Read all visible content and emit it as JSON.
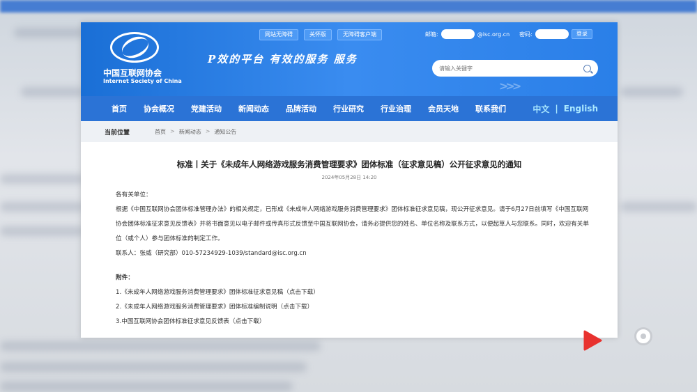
{
  "site": {
    "logo_cn": "中国互联网协会",
    "logo_en": "Internet Society of China",
    "slogan": "P效的平台   有效的服务   服务"
  },
  "topbar": {
    "buttons": [
      "网站无障碍",
      "关怀版",
      "无障碍客户端"
    ],
    "email_label": "邮箱:",
    "email_suffix": "@isc.org.cn",
    "password_label": "密码:",
    "login_label": "登录"
  },
  "search": {
    "placeholder": "请输入关键字"
  },
  "nav": {
    "items": [
      "首页",
      "协会概况",
      "党建活动",
      "新闻动态",
      "品牌活动",
      "行业研究",
      "行业治理",
      "会员天地",
      "联系我们"
    ],
    "lang_cn": "中文",
    "lang_sep": "|",
    "lang_en": "English"
  },
  "breadcrumb": {
    "title": "当前位置",
    "items": [
      "首页",
      "新闻动态",
      "通知公告"
    ],
    "sep": ">"
  },
  "article": {
    "title": "标准丨关于《未成年人网络游戏服务消费管理要求》团体标准（征求意见稿）公开征求意见的通知",
    "date": "2024年05月28日 14:20",
    "greeting": "各有关单位：",
    "para1": "根据《中国互联网协会团体标准管理办法》的相关规定，已形成《未成年人网络游戏服务消费管理要求》团体标准征求意见稿，现公开征求意见。请于6月27日前填写《中国互联网协会团体标准征求意见反馈表》并将书面意见以电子邮件或传真形式反馈至中国互联网协会，请务必提供您的姓名、单位名称及联系方式，以便起草人与您联系。同时，欢迎有关单位（或个人）参与团体标准的制定工作。",
    "contact": "联系人：张威（研究部）010-57234929-1039/standard@isc.org.cn",
    "attach_header": "附件：",
    "attachments": [
      "1.《未成年人网络游戏服务消费管理要求》团体标准征求意见稿（点击下载）",
      "2.《未成年人网络游戏服务消费管理要求》团体标准编制说明（点击下载）",
      "3.中国互联网协会团体标准征求意见反馈表（点击下载）"
    ]
  },
  "overlay": {
    "play_color": "#e8322f"
  }
}
